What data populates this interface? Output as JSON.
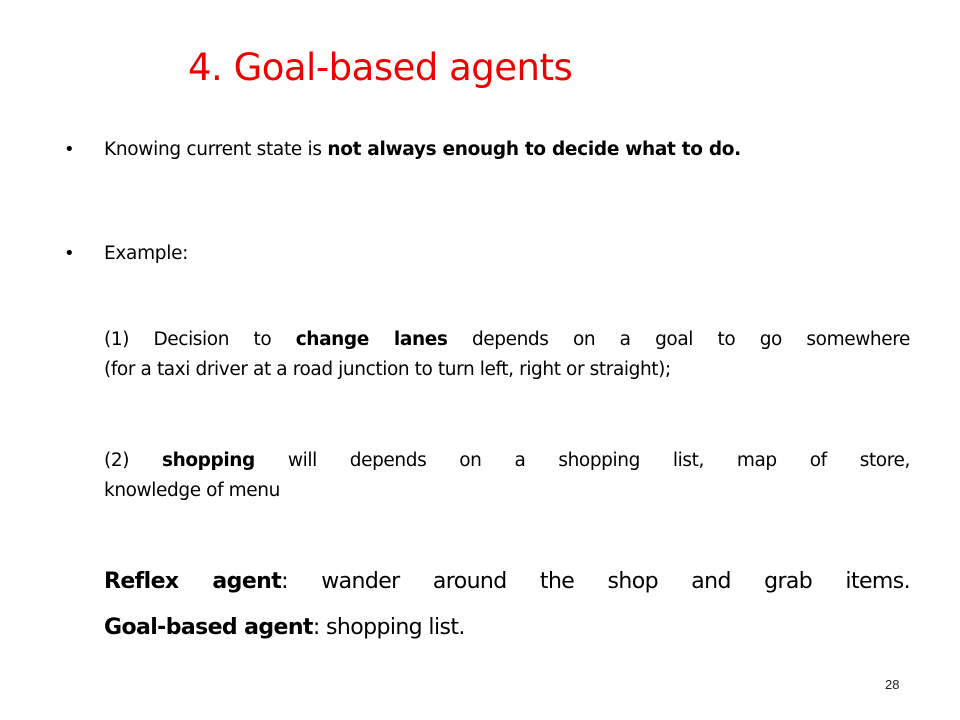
{
  "slide": {
    "title": "4. Goal-based agents",
    "title_color": "#ee0000",
    "bullets": [
      {
        "icon": "bullet-dot",
        "glyph": "•",
        "text_plain": "Knowing current state is ",
        "text_bold": "not always enough to decide what to do."
      },
      {
        "icon": "bullet-dot",
        "glyph": "•",
        "text_plain": "Example:"
      }
    ],
    "example_1": {
      "line1_a": "(1) Decision to ",
      "line1_bold": "change lanes",
      "line1_b": " depends on a goal to go somewhere",
      "line2": "(for a taxi driver at a road junction to turn left, right or straight);"
    },
    "example_2": {
      "line1_a": "(2) ",
      "line1_bold": "shopping",
      "line1_b": " will depends on a shopping list, map of store,",
      "line2": "knowledge of menu"
    },
    "summary": {
      "reflex_label": "Reflex agent",
      "reflex_text": ": wander around the shop and grab items.",
      "goal_label": "Goal-based agent",
      "goal_text": ": shopping list."
    },
    "page_number": "28"
  }
}
